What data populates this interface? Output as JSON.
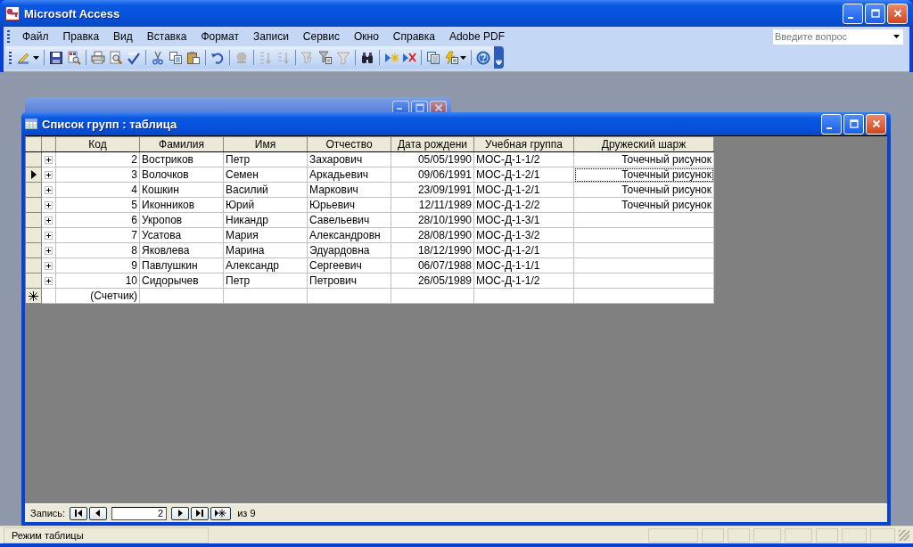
{
  "window": {
    "title": "Microsoft Access"
  },
  "menu": [
    "Файл",
    "Правка",
    "Вид",
    "Вставка",
    "Формат",
    "Записи",
    "Сервис",
    "Окно",
    "Справка",
    "Adobe PDF"
  ],
  "help_search": {
    "placeholder": "Введите вопрос"
  },
  "child_window": {
    "title": "Список групп : таблица"
  },
  "table": {
    "columns": [
      {
        "label": "Код",
        "kind": "counter"
      },
      {
        "label": "Фамилия",
        "kind": "text"
      },
      {
        "label": "Имя",
        "kind": "text"
      },
      {
        "label": "Отчество",
        "kind": "text"
      },
      {
        "label": "Дата рождени",
        "kind": "date"
      },
      {
        "label": "Учебная группа",
        "kind": "text"
      },
      {
        "label": "Дружеский шарж",
        "kind": "object"
      }
    ],
    "rows": [
      {
        "current": false,
        "cells": [
          "2",
          "Востриков",
          "Петр",
          "Захарович",
          "05/05/1990",
          "МОС-Д-1-1/2",
          "Точечный рисунок"
        ]
      },
      {
        "current": true,
        "cells": [
          "3",
          "Волочков",
          "Семен",
          "Аркадьевич",
          "09/06/1991",
          "МОС-Д-1-2/1",
          {
            "text": "Точечный рисунок",
            "focused": true
          }
        ]
      },
      {
        "current": false,
        "cells": [
          "4",
          "Кошкин",
          "Василий",
          "Маркович",
          "23/09/1991",
          "МОС-Д-1-2/1",
          "Точечный рисунок"
        ]
      },
      {
        "current": false,
        "cells": [
          "5",
          "Иконников",
          "Юрий",
          "Юрьевич",
          "12/11/1989",
          "МОС-Д-1-2/2",
          "Точечный рисунок"
        ]
      },
      {
        "current": false,
        "cells": [
          "6",
          "Укропов",
          "Никандр",
          "Савельевич",
          "28/10/1990",
          "МОС-Д-1-3/1"
        ]
      },
      {
        "current": false,
        "cells": [
          "7",
          "Усатова",
          "Мария",
          "Александровн",
          "28/08/1990",
          "МОС-Д-1-3/2"
        ]
      },
      {
        "current": false,
        "cells": [
          "8",
          "Яковлева",
          "Марина",
          "Эдуардовна",
          "18/12/1990",
          "МОС-Д-1-2/1"
        ]
      },
      {
        "current": false,
        "cells": [
          "9",
          "Павлушкин",
          "Александр",
          "Сергеевич",
          "06/07/1988",
          "МОС-Д-1-1/1"
        ]
      },
      {
        "current": false,
        "cells": [
          "10",
          "Сидорычев",
          "Петр",
          "Петрович",
          "26/05/1989",
          "МОС-Д-1-1/2"
        ]
      }
    ],
    "new_row": {
      "cells": [
        "(Счетчик)"
      ]
    }
  },
  "navigator": {
    "label": "Запись:",
    "value": "2",
    "total": "из 9"
  },
  "status_bar": {
    "text": "Режим таблицы"
  }
}
